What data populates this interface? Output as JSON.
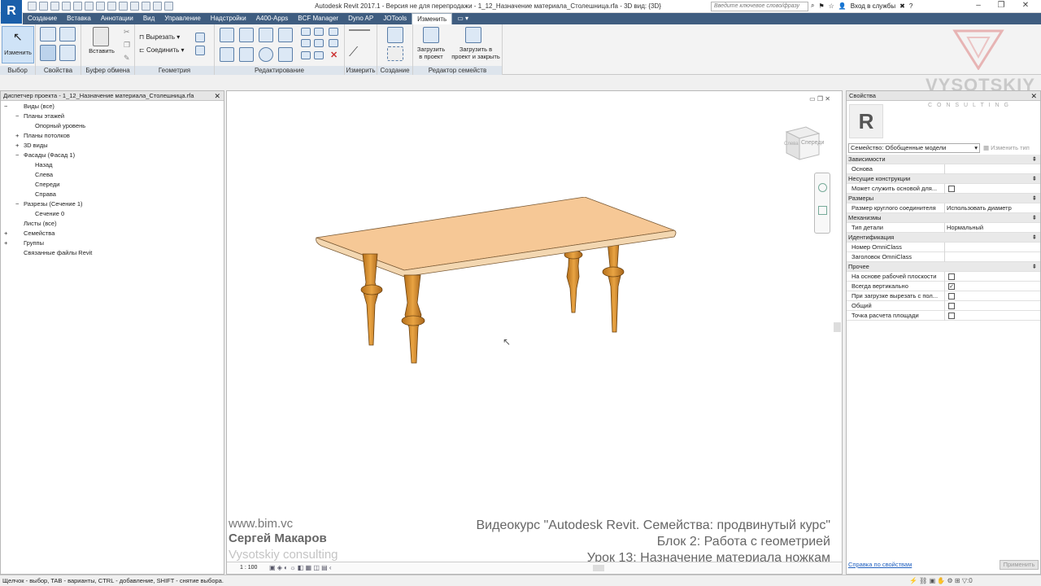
{
  "app": {
    "window_title": "Autodesk Revit 2017.1 - Версия не для перепродажи -    1_12_Назначение материала_Столешница.rfa - 3D вид: {3D}",
    "logo_letter": "R",
    "search_placeholder": "Введите ключевое слово/фразу",
    "login_label": "Вход в службы",
    "help_label": "?"
  },
  "tabs": [
    "Создание",
    "Вставка",
    "Аннотации",
    "Вид",
    "Управление",
    "Надстройки",
    "A400-Apps",
    "BCF Manager",
    "Dyno AP",
    "JOTools",
    "Изменить"
  ],
  "ribbon": {
    "modify_label": "Изменить",
    "cut_label": "Вырезать",
    "join_label": "Соединить",
    "paste_label": "Вставить",
    "load_project_label_1": "Загрузить",
    "load_project_label_2": "в проект",
    "load_close_label_1": "Загрузить в",
    "load_close_label_2": "проект и закрыть",
    "groups": {
      "select": "Выбор",
      "properties": "Свойства",
      "clipboard": "Буфер обмена",
      "geometry": "Геометрия",
      "modify": "Редактирование",
      "measure": "Измерить",
      "create": "Создание",
      "family_editor": "Редактор семейств"
    }
  },
  "project_browser": {
    "title": "Диспетчер проекта - 1_12_Назначение материала_Столешница.rfa",
    "items": [
      {
        "label": "Виды (все)",
        "expander": "−"
      },
      {
        "label": "Планы этажей",
        "expander": "−"
      },
      {
        "label": "Опорный уровень",
        "expander": ""
      },
      {
        "label": "Планы потолков",
        "expander": "+"
      },
      {
        "label": "3D виды",
        "expander": "+"
      },
      {
        "label": "Фасады (Фасад 1)",
        "expander": "−"
      },
      {
        "label": "Назад",
        "expander": ""
      },
      {
        "label": "Слева",
        "expander": ""
      },
      {
        "label": "Спереди",
        "expander": ""
      },
      {
        "label": "Справа",
        "expander": ""
      },
      {
        "label": "Разрезы (Сечение 1)",
        "expander": "−"
      },
      {
        "label": "Сечение 0",
        "expander": ""
      },
      {
        "label": "Листы (все)",
        "expander": ""
      },
      {
        "label": "Семейства",
        "expander": "+"
      },
      {
        "label": "Группы",
        "expander": "+"
      },
      {
        "label": "Связанные файлы Revit",
        "expander": ""
      }
    ]
  },
  "viewport": {
    "viewcube_face": "Спереди",
    "viewcube_side": "Слева",
    "scale": "1 : 100"
  },
  "watermark": {
    "site": "www.bim.vc",
    "author": "Сергей Макаров",
    "company": "Vysotskiy consulting",
    "course": "Видеокурс \"Autodesk Revit. Семейства: продвинутый курс\"",
    "block": "Блок 2: Работа с геометрией",
    "lesson": "Урок 13: Назначение материала ножкам",
    "logo_text": "VYSOTSKIY",
    "logo_sub": "C O N S U L T I N G"
  },
  "properties": {
    "title": "Свойства",
    "type_selector": "Семейство: Обобщенные модели",
    "edit_type": "Изменить тип",
    "help_link": "Справка по свойствам",
    "apply": "Применить",
    "rows": [
      {
        "kind": "section",
        "name": "Зависимости"
      },
      {
        "kind": "param",
        "name": "Основа",
        "value": ""
      },
      {
        "kind": "section",
        "name": "Несущие конструкции"
      },
      {
        "kind": "check",
        "name": "Может служить основой для...",
        "checked": ""
      },
      {
        "kind": "section",
        "name": "Размеры"
      },
      {
        "kind": "param",
        "name": "Размер круглого соединителя",
        "value": "Использовать диаметр"
      },
      {
        "kind": "section",
        "name": "Механизмы"
      },
      {
        "kind": "param",
        "name": "Тип детали",
        "value": "Нормальный"
      },
      {
        "kind": "section",
        "name": "Идентификация"
      },
      {
        "kind": "param",
        "name": "Номер OmniClass",
        "value": ""
      },
      {
        "kind": "param",
        "name": "Заголовок OmniClass",
        "value": ""
      },
      {
        "kind": "section",
        "name": "Прочее"
      },
      {
        "kind": "check",
        "name": "На основе рабочей плоскости",
        "checked": ""
      },
      {
        "kind": "check",
        "name": "Всегда вертикально",
        "checked": "✓"
      },
      {
        "kind": "check",
        "name": "При загрузке вырезать с пол...",
        "checked": ""
      },
      {
        "kind": "check",
        "name": "Общий",
        "checked": ""
      },
      {
        "kind": "check",
        "name": "Точка расчета площади",
        "checked": ""
      }
    ]
  },
  "status": {
    "hint": "Щелчок - выбор, TAB - варианты, CTRL - добавление, SHIFT - снятие выбора.",
    "filter_count": ":0"
  }
}
